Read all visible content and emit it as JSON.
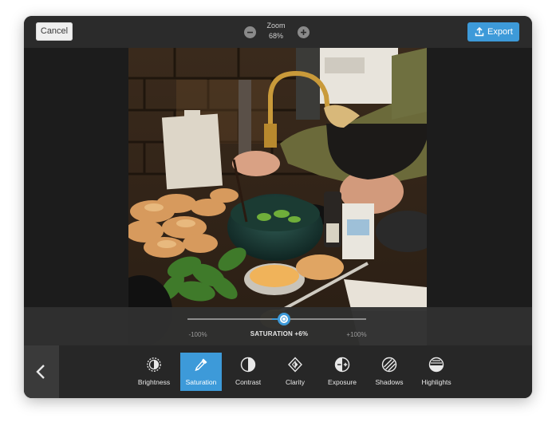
{
  "topbar": {
    "cancel_label": "Cancel",
    "zoom_label": "Zoom",
    "zoom_value": "68%",
    "export_label": "Export"
  },
  "slider": {
    "adjustment": "SATURATION",
    "value_text": "+6%",
    "label": "SATURATION +6%",
    "min_label": "-100%",
    "max_label": "+100%",
    "value": 6,
    "min": -100,
    "max": 100
  },
  "tools": [
    {
      "label": "Brightness",
      "icon": "brightness-icon",
      "active": false
    },
    {
      "label": "Saturation",
      "icon": "eyedropper-icon",
      "active": true
    },
    {
      "label": "Contrast",
      "icon": "contrast-icon",
      "active": false
    },
    {
      "label": "Clarity",
      "icon": "clarity-icon",
      "active": false
    },
    {
      "label": "Exposure",
      "icon": "exposure-icon",
      "active": false
    },
    {
      "label": "Shadows",
      "icon": "shadows-icon",
      "active": false
    },
    {
      "label": "Highlights",
      "icon": "highlights-icon",
      "active": false
    }
  ],
  "colors": {
    "accent": "#3d9ad9",
    "panel": "#272727",
    "canvas": "#1c1c1c"
  }
}
